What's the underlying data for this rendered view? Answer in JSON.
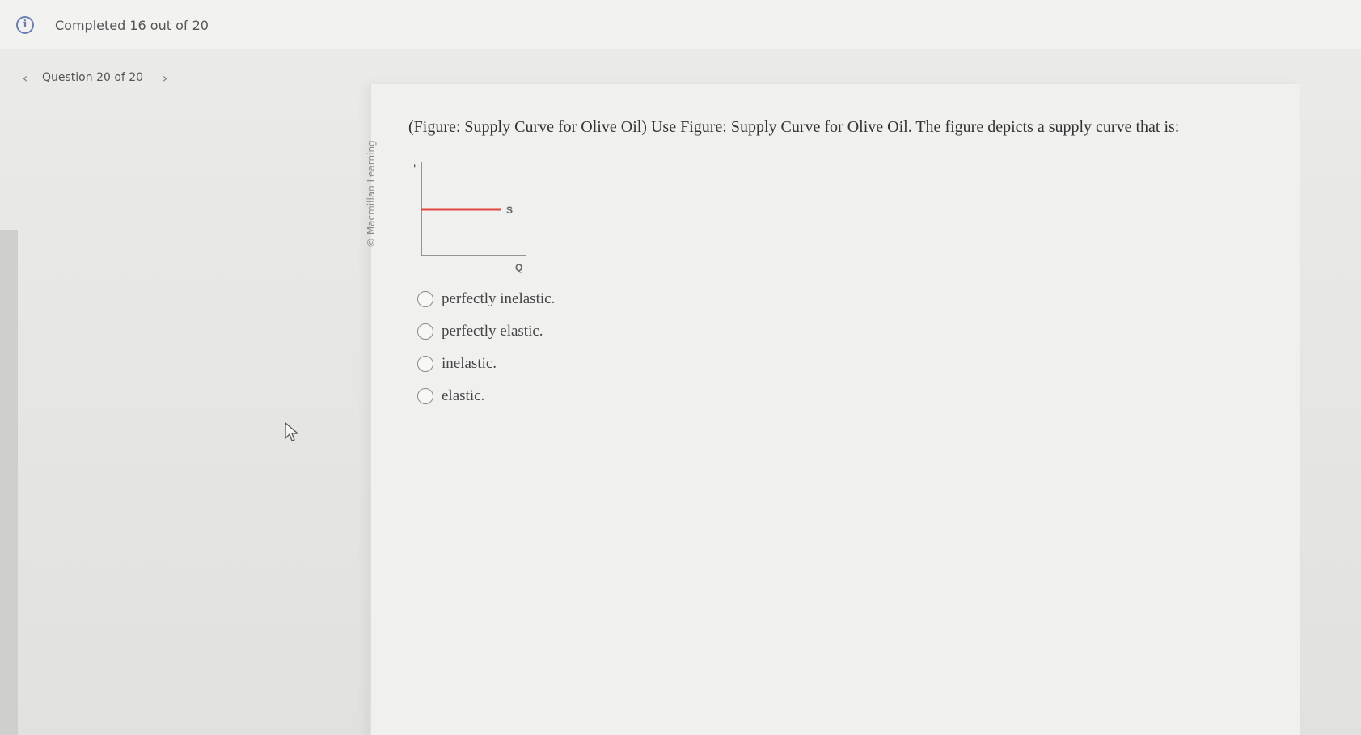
{
  "header": {
    "progress_text": "Completed 16 out of 20"
  },
  "nav": {
    "question_label": "Question 20 of 20"
  },
  "content": {
    "credit": "© Macmillan Learning",
    "question_text": "(Figure: Supply Curve for Olive Oil) Use Figure: Supply Curve for Olive Oil. The figure depicts a supply curve that is:",
    "options": [
      {
        "label": "perfectly inelastic."
      },
      {
        "label": "perfectly elastic."
      },
      {
        "label": "inelastic."
      },
      {
        "label": "elastic."
      }
    ]
  },
  "figure": {
    "y_label": "P",
    "x_label": "Q",
    "curve_label": "S",
    "curve_color": "#e2473f"
  },
  "icons": {
    "info": "info-icon",
    "prev": "chevron-left-icon",
    "next": "chevron-right-icon",
    "cursor": "mouse-pointer-icon"
  },
  "colors": {
    "accent": "#6a7fb0",
    "curve": "#e2473f"
  }
}
